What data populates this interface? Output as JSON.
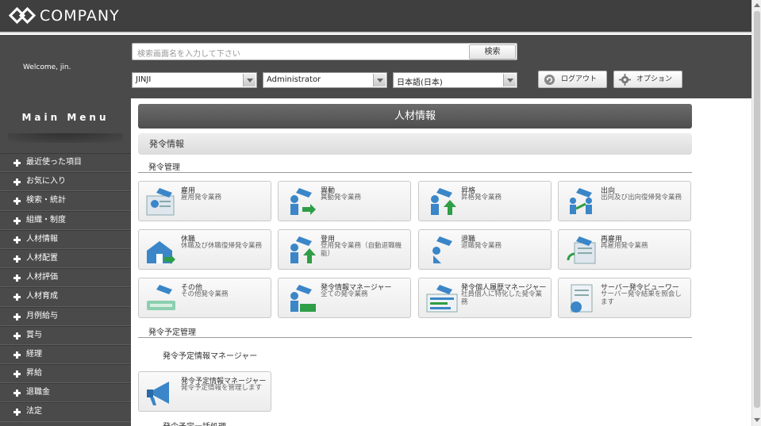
{
  "app": {
    "logo_text": "COMPANY"
  },
  "header": {
    "welcome": "Welcome, jin.",
    "search_placeholder": "検索画面名を入力して下さい",
    "search_button": "検索",
    "select_1": "JINJI",
    "select_2": "Administrator",
    "select_3": "日本語(日本)",
    "logout": "ログアウト",
    "options": "オプション"
  },
  "sidebar": {
    "title": "Main Menu",
    "items": [
      {
        "label": "最近使った項目"
      },
      {
        "label": "お気に入り"
      },
      {
        "label": "検索・統計"
      },
      {
        "label": "組織・制度"
      },
      {
        "label": "人材情報"
      },
      {
        "label": "人材配置"
      },
      {
        "label": "人材評価"
      },
      {
        "label": "人材育成"
      },
      {
        "label": "月例給与"
      },
      {
        "label": "賞与"
      },
      {
        "label": "経理"
      },
      {
        "label": "昇給"
      },
      {
        "label": "退職金"
      },
      {
        "label": "法定"
      }
    ]
  },
  "main": {
    "title": "人材情報",
    "subtitle": "発令情報",
    "section1": "発令管理",
    "cards": [
      {
        "title": "雇用",
        "desc": "雇用発令業務"
      },
      {
        "title": "異動",
        "desc": "異動発令業務"
      },
      {
        "title": "昇格",
        "desc": "昇格発令業務"
      },
      {
        "title": "出向",
        "desc": "出向及び出向復帰発令業務"
      },
      {
        "title": "休職",
        "desc": "休職及び休職復帰発令業務"
      },
      {
        "title": "登用",
        "desc": "登用発令業務（自動退職機能）"
      },
      {
        "title": "退職",
        "desc": "退職発令業務"
      },
      {
        "title": "再雇用",
        "desc": "再雇用発令業務"
      },
      {
        "title": "その他",
        "desc": "その他発令業務"
      },
      {
        "title": "発令情報マネージャー",
        "desc": "全ての発令業務"
      },
      {
        "title": "発令個人履歴マネージャー",
        "desc": "社員個人に特化した発令業務"
      },
      {
        "title": "サーバー発令ビューワー",
        "desc": "サーバー発令結果を照会します"
      }
    ],
    "section2": "発令予定管理",
    "sub_heading": "発令予定情報マネージャー",
    "card_plan": {
      "title": "発令予定情報マネージャー",
      "desc": "発令予定情報を管理します"
    },
    "section3": "発令予定一括処理"
  },
  "colors": {
    "header_bg": "#4a4a4a",
    "accent_blue": "#3a86c8",
    "accent_green": "#2e9e47"
  }
}
